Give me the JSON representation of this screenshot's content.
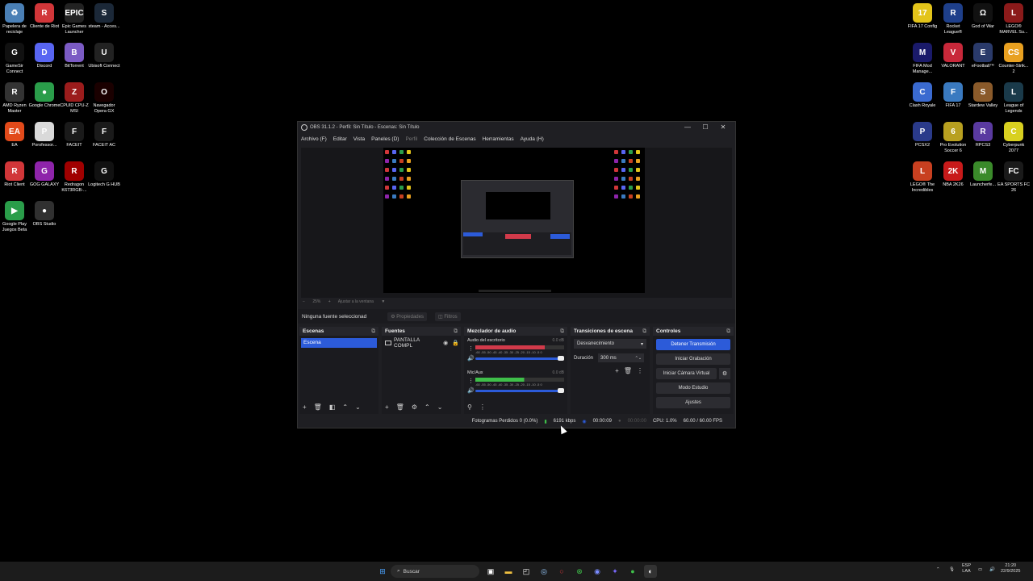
{
  "desktop_left": [
    {
      "label": "Papelera de reciclaje",
      "icon": "recycle-bin-icon",
      "color": "#4a7fb5",
      "glyph": "♻"
    },
    {
      "label": "Cliente de Riot",
      "icon": "riot-client-icon",
      "color": "#d13639",
      "glyph": "R"
    },
    {
      "label": "Epic Games Launcher",
      "icon": "epic-games-icon",
      "color": "#222222",
      "glyph": "EPIC"
    },
    {
      "label": "steam - Acces...",
      "icon": "steam-icon",
      "color": "#1b2838",
      "glyph": "S"
    },
    {
      "label": "GameSir Connect",
      "icon": "gamesir-icon",
      "color": "#111111",
      "glyph": "G"
    },
    {
      "label": "Discord",
      "icon": "discord-icon",
      "color": "#5865f2",
      "glyph": "D"
    },
    {
      "label": "BitTorrent",
      "icon": "bittorrent-icon",
      "color": "#7b5bc4",
      "glyph": "B"
    },
    {
      "label": "Ubisoft Connect",
      "icon": "ubisoft-icon",
      "color": "#222222",
      "glyph": "U"
    },
    {
      "label": "AMD Ryzen Master",
      "icon": "amd-icon",
      "color": "#333333",
      "glyph": "R"
    },
    {
      "label": "Google Chrome",
      "icon": "chrome-icon",
      "color": "#2a9d4a",
      "glyph": "●"
    },
    {
      "label": "CPUID CPU-Z MSI",
      "icon": "cpuz-icon",
      "color": "#9b1c1c",
      "glyph": "Z"
    },
    {
      "label": "Navegador Opera GX",
      "icon": "opera-gx-icon",
      "color": "#1a0000",
      "glyph": "O"
    },
    {
      "label": "EA",
      "icon": "ea-icon",
      "color": "#e24a1a",
      "glyph": "EA"
    },
    {
      "label": "Porofessor...",
      "icon": "porofessor-icon",
      "color": "#d9d9d9",
      "glyph": "P"
    },
    {
      "label": "FACEIT",
      "icon": "faceit-icon",
      "color": "#1a1a1a",
      "glyph": "F"
    },
    {
      "label": "FACEIT AC",
      "icon": "faceit-ac-icon",
      "color": "#1a1a1a",
      "glyph": "F"
    },
    {
      "label": "Riot Client",
      "icon": "riot-client-2-icon",
      "color": "#d13639",
      "glyph": "R"
    },
    {
      "label": "GOG GALAXY",
      "icon": "gog-icon",
      "color": "#8e24aa",
      "glyph": "G"
    },
    {
      "label": "Redragon K673RGB-...",
      "icon": "redragon-icon",
      "color": "#a00000",
      "glyph": "R"
    },
    {
      "label": "Logitech G HUB",
      "icon": "logitech-icon",
      "color": "#111111",
      "glyph": "G"
    },
    {
      "label": "Google Play Juegos Beta",
      "icon": "google-play-games-icon",
      "color": "#2a9d4a",
      "glyph": "▶"
    },
    {
      "label": "OBS Studio",
      "icon": "obs-studio-icon",
      "color": "#303030",
      "glyph": "●"
    }
  ],
  "desktop_right": [
    {
      "label": "FIFA 17 Config",
      "icon": "fifa17-config-icon",
      "color": "#e3c41a",
      "glyph": "17"
    },
    {
      "label": "Rocket League®",
      "icon": "rocket-league-icon",
      "color": "#1e3f8a",
      "glyph": "R"
    },
    {
      "label": "God of War",
      "icon": "god-of-war-icon",
      "color": "#111111",
      "glyph": "Ω"
    },
    {
      "label": "LEGO® MARVEL Su...",
      "icon": "lego-marvel-icon",
      "color": "#8b1a1a",
      "glyph": "L"
    },
    {
      "label": "FIFA Mod Manage...",
      "icon": "fifa-mod-manager-icon",
      "color": "#1a1a6a",
      "glyph": "M"
    },
    {
      "label": "VALORANT",
      "icon": "valorant-icon",
      "color": "#c8283a",
      "glyph": "V"
    },
    {
      "label": "eFootball™",
      "icon": "efootball-icon",
      "color": "#2a3a6a",
      "glyph": "E"
    },
    {
      "label": "Counter-Strik... 2",
      "icon": "counter-strike-icon",
      "color": "#e8a020",
      "glyph": "CS"
    },
    {
      "label": "Clash Royale",
      "icon": "clash-royale-icon",
      "color": "#3a6ad0",
      "glyph": "C"
    },
    {
      "label": "FIFA 17",
      "icon": "fifa17-icon",
      "color": "#3a7ac0",
      "glyph": "F"
    },
    {
      "label": "Stardew Valley",
      "icon": "stardew-valley-icon",
      "color": "#8a5a2a",
      "glyph": "S"
    },
    {
      "label": "League of Legends",
      "icon": "league-icon",
      "color": "#1a3a4a",
      "glyph": "L"
    },
    {
      "label": "PCSX2",
      "icon": "pcsx2-icon",
      "color": "#2a3a8a",
      "glyph": "P"
    },
    {
      "label": "Pro Evolution Soccer 6",
      "icon": "pes6-icon",
      "color": "#b8a020",
      "glyph": "6"
    },
    {
      "label": "RPCS3",
      "icon": "rpcs3-icon",
      "color": "#5a3aa0",
      "glyph": "R"
    },
    {
      "label": "Cyberpunk 2077",
      "icon": "cyberpunk-icon",
      "color": "#d8d020",
      "glyph": "C"
    },
    {
      "label": "LEGO® The Incredibles",
      "icon": "lego-incredibles-icon",
      "color": "#c84020",
      "glyph": "L"
    },
    {
      "label": "NBA 2K26",
      "icon": "nba2k26-icon",
      "color": "#c81a1a",
      "glyph": "2K"
    },
    {
      "label": "Launcherfe...",
      "icon": "minecraft-launcher-icon",
      "color": "#3a8a2a",
      "glyph": "M"
    },
    {
      "label": "EA SPORTS FC 26",
      "icon": "ea-fc26-icon",
      "color": "#1a1a1a",
      "glyph": "FC"
    }
  ],
  "obs": {
    "title": "OBS 31.1.2 - Perfil: Sin Título - Escenas: Sin Título",
    "window_min": "—",
    "window_max": "☐",
    "window_close": "✕",
    "menu": [
      "Archivo (F)",
      "Editar",
      "Vista",
      "Paneles (D)",
      "Perfil",
      "Colección de Escenas",
      "Herramientas",
      "Ayuda (H)"
    ],
    "zoom_minus": "−",
    "zoom": "25%",
    "zoom_plus": "+",
    "fit": "Ajustar a la ventana",
    "fit_arrow": "▼",
    "no_source": "Ninguna fuente seleccionad",
    "properties": "Propiedades",
    "filters": "Filtros",
    "docks": {
      "scenes": {
        "title": "Escenas",
        "item": "Escena"
      },
      "sources": {
        "title": "Fuentes",
        "item": "PANTALLA COMPL"
      },
      "mixer": {
        "title": "Mezclador de audio",
        "channels": [
          {
            "name": "Audio del escritorio",
            "db": "0.0 dB",
            "level": 0.78
          },
          {
            "name": "Mic/Aux",
            "db": "0.0 dB",
            "level": 0.55
          }
        ],
        "ticks": "-60 -55 -50 -45 -40 -35 -30 -25 -20 -15 -10 -5 0"
      },
      "transitions": {
        "title": "Transiciones de escena",
        "selected": "Desvanecimiento",
        "duration_label": "Duración",
        "duration_value": "300 ms"
      },
      "controls": {
        "title": "Controles",
        "stop_stream": "Detener Transmisión",
        "start_record": "Iniciar Grabación",
        "virtual_cam": "Iniciar Cámara Virtual",
        "studio_mode": "Modo Estudio",
        "settings": "Ajustes"
      }
    },
    "status": {
      "dropped": "Fotogramas Perdidos 0 (0.0%)",
      "bitrate": "6191 kbps",
      "stream_time": "00:00:09",
      "rec_time": "00:00:00",
      "cpu": "CPU: 1.0%",
      "fps": "60.00 / 60.00 FPS"
    }
  },
  "taskbar": {
    "search": "Buscar",
    "lang": "ESP",
    "lang2": "LAA",
    "time": "21:20",
    "date": "22/9/2025",
    "colors": {
      "accent": "#2c5bd9",
      "mixer_red": "#d13a4a",
      "mixer_green": "#3fbf4a"
    }
  }
}
